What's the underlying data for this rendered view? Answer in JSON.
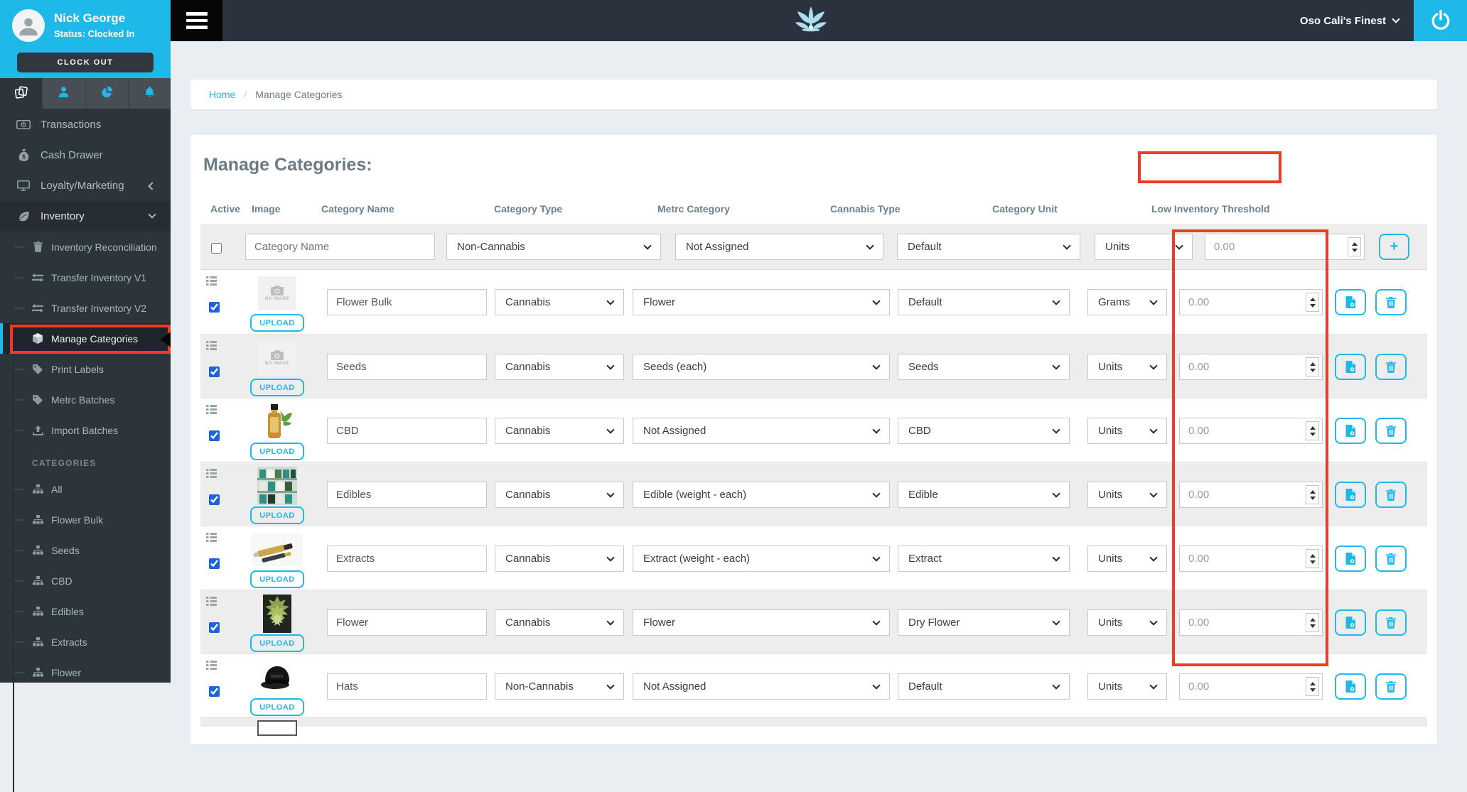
{
  "user_panel": {
    "name": "Nick George",
    "status": "Status: Clocked In",
    "clock_out": "CLOCK OUT"
  },
  "topbar": {
    "store": "Oso Cali's Finest"
  },
  "breadcrumb": {
    "home": "Home",
    "sep": "/",
    "current": "Manage Categories"
  },
  "sidebar": {
    "menu": [
      {
        "label": "Transactions"
      },
      {
        "label": "Cash Drawer"
      },
      {
        "label": "Loyalty/Marketing"
      },
      {
        "label": "Inventory"
      }
    ],
    "submenu": [
      {
        "label": "Inventory Reconciliation"
      },
      {
        "label": "Transfer Inventory V1"
      },
      {
        "label": "Transfer Inventory V2"
      },
      {
        "label": "Manage Categories"
      },
      {
        "label": "Print Labels"
      },
      {
        "label": "Metrc Batches"
      },
      {
        "label": "Import Batches"
      }
    ],
    "categories_heading": "CATEGORIES",
    "categories": [
      {
        "label": "All"
      },
      {
        "label": "Flower Bulk"
      },
      {
        "label": "Seeds"
      },
      {
        "label": "CBD"
      },
      {
        "label": "Edibles"
      },
      {
        "label": "Extracts"
      },
      {
        "label": "Flower"
      }
    ]
  },
  "page": {
    "title": "Manage Categories:"
  },
  "table": {
    "headers": {
      "active": "Active",
      "image": "Image",
      "name": "Category Name",
      "type": "Category Type",
      "metrc": "Metrc Category",
      "cannabis": "Cannabis Type",
      "unit": "Category Unit",
      "threshold": "Low Inventory Threshold"
    },
    "filter": {
      "name_placeholder": "Category Name",
      "type": "Non-Cannabis",
      "metrc": "Not Assigned",
      "cannabis": "Default",
      "unit": "Units",
      "threshold": "0.00",
      "add": "+"
    },
    "upload": "UPLOAD",
    "no_image": "NO IMAGE",
    "rows": [
      {
        "name": "Flower Bulk",
        "type": "Cannabis",
        "metrc": "Flower",
        "cannabis": "Default",
        "unit": "Grams",
        "threshold": "0.00"
      },
      {
        "name": "Seeds",
        "type": "Cannabis",
        "metrc": "Seeds (each)",
        "cannabis": "Seeds",
        "unit": "Units",
        "threshold": "0.00"
      },
      {
        "name": "CBD",
        "type": "Cannabis",
        "metrc": "Not Assigned",
        "cannabis": "CBD",
        "unit": "Units",
        "threshold": "0.00"
      },
      {
        "name": "Edibles",
        "type": "Cannabis",
        "metrc": "Edible (weight - each)",
        "cannabis": "Edible",
        "unit": "Units",
        "threshold": "0.00"
      },
      {
        "name": "Extracts",
        "type": "Cannabis",
        "metrc": "Extract (weight - each)",
        "cannabis": "Extract",
        "unit": "Units",
        "threshold": "0.00"
      },
      {
        "name": "Flower",
        "type": "Cannabis",
        "metrc": "Flower",
        "cannabis": "Dry Flower",
        "unit": "Units",
        "threshold": "0.00"
      },
      {
        "name": "Hats",
        "type": "Non-Cannabis",
        "metrc": "Not Assigned",
        "cannabis": "Default",
        "unit": "Units",
        "threshold": "0.00"
      }
    ]
  },
  "colors": {
    "accent": "#1fb9e9",
    "annotation": "#ee3b24",
    "sidebar_bg": "#2d353c",
    "topbar_bg": "#2a323d",
    "checkbox": "#1566e0"
  }
}
